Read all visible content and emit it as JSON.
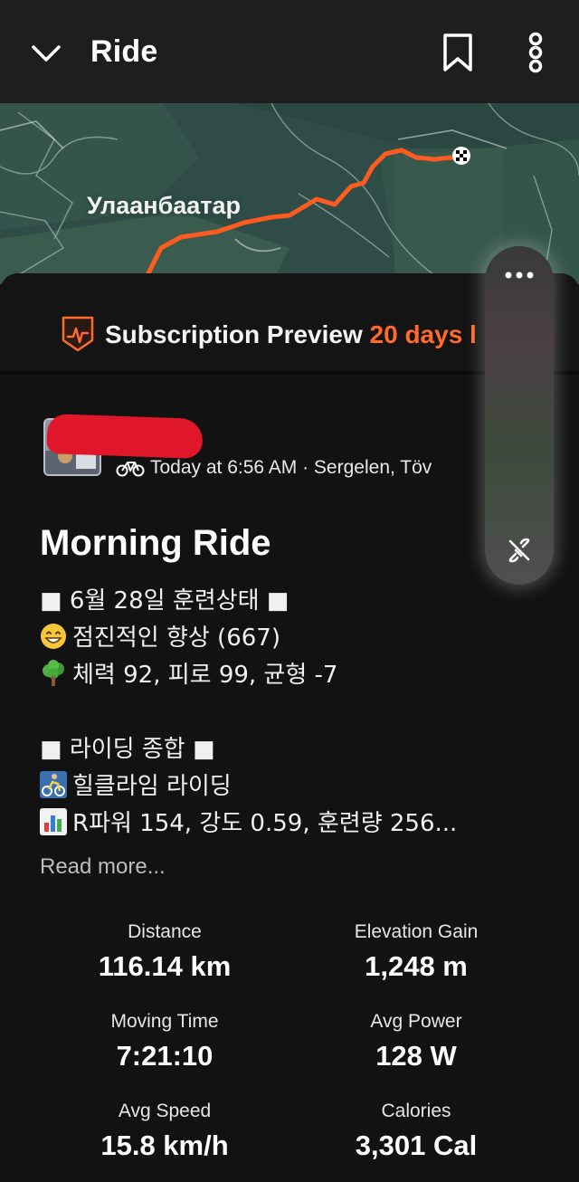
{
  "header": {
    "title": "Ride",
    "icons": [
      "chevron-down-icon",
      "bookmark-icon",
      "more-vertical-icon"
    ]
  },
  "map": {
    "place_label": "Улаанбаатар",
    "route_color": "#ff5a1f"
  },
  "subscription": {
    "label": "Subscription Preview",
    "days": "20 days l",
    "accent_color": "#ff6a2b"
  },
  "activity": {
    "meta": "Today at 6:56 AM · Sergelen, Töv",
    "title": "Morning Ride",
    "description": [
      "■ 6월 28일 훈련상태 ■",
      "점진적인 향상 (667)",
      "체력 92, 피로 99, 균형 -7",
      "■ 라이딩 종합 ■",
      "힐클라임 라이딩",
      "R파워 154, 강도 0.59, 훈련량 256..."
    ],
    "read_more": "Read more..."
  },
  "stats": [
    {
      "label": "Distance",
      "value": "116.14 km"
    },
    {
      "label": "Elevation Gain",
      "value": "1,248 m"
    },
    {
      "label": "Moving Time",
      "value": "7:21:10"
    },
    {
      "label": "Avg Power",
      "value": "128 W"
    },
    {
      "label": "Avg Speed",
      "value": "15.8 km/h"
    },
    {
      "label": "Calories",
      "value": "3,301 Cal"
    }
  ]
}
